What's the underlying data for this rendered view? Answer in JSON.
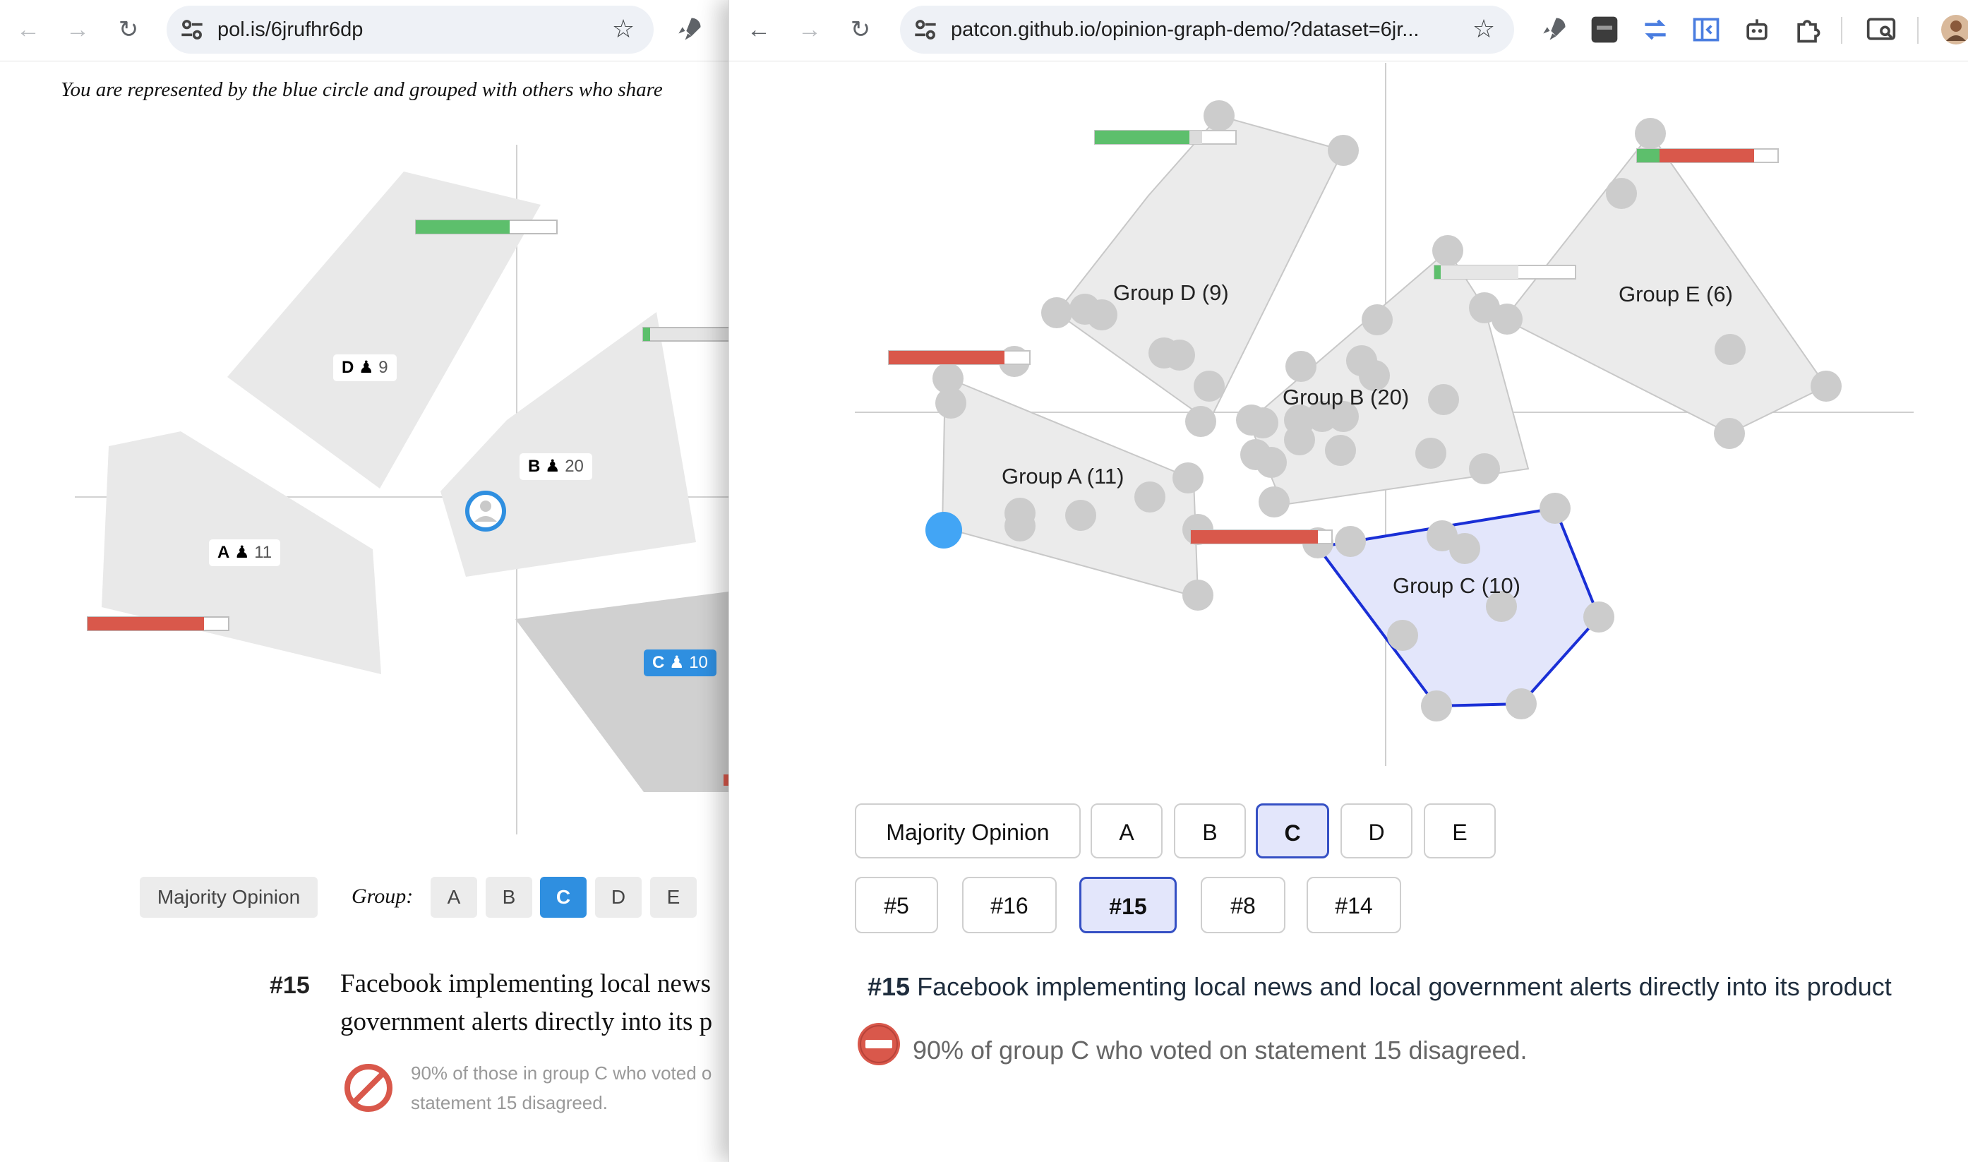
{
  "left_window": {
    "url": "pol.is/6jrufhr6dp",
    "intro_text": "You are represented by the blue circle and grouped with others who share",
    "groups": [
      {
        "id": "A",
        "count": "11"
      },
      {
        "id": "B",
        "count": "20"
      },
      {
        "id": "C",
        "count": "10"
      },
      {
        "id": "D",
        "count": "9"
      }
    ],
    "majority_label": "Majority Opinion",
    "group_label": "Group:",
    "group_buttons": [
      "A",
      "B",
      "C",
      "D",
      "E"
    ],
    "selected_group": "C",
    "statement_number": "#15",
    "statement_line1": "Facebook implementing local news",
    "statement_line2": "government alerts directly into its p",
    "note_line1": "90% of those in group C who voted o",
    "note_line2": "statement 15 disagreed."
  },
  "right_window": {
    "url": "patcon.github.io/opinion-graph-demo/?dataset=6jr...",
    "group_labels": [
      "Group D (9)",
      "Group B (20)",
      "Group E (6)",
      "Group A (11)",
      "Group C (10)"
    ],
    "group_buttons": [
      "Majority Opinion",
      "A",
      "B",
      "C",
      "D",
      "E"
    ],
    "selected_group": "C",
    "statement_buttons": [
      "#5",
      "#16",
      "#15",
      "#8",
      "#14"
    ],
    "selected_statement": "#15",
    "statement_number": "#15",
    "statement_text": "Facebook implementing local news and local government alerts directly into its product",
    "vote_note": "90% of group C who voted on statement 15 disagreed."
  },
  "colors": {
    "agree": "#5dbf6c",
    "disagree": "#d9584b",
    "polis_blue": "#2f8fe0",
    "selected_hull_fill": "#e3e6fb",
    "selected_hull_stroke": "#1a2fd6"
  }
}
